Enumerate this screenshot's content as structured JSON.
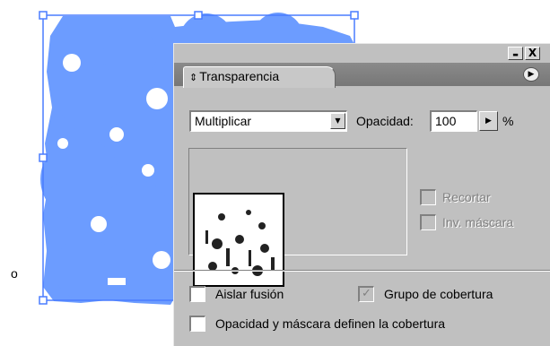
{
  "panel": {
    "tab_label": "Transparencia",
    "tab_icon": "double-arrow-icon",
    "minimize_symbol": "▬",
    "close_symbol": "X",
    "menu_symbol": "▶",
    "blend_mode": "Multiplicar",
    "opacity_label": "Opacidad:",
    "opacity_value": "100",
    "opacity_unit": "%",
    "clip_label": "Recortar",
    "invert_mask_label": "Inv. máscara",
    "isolate_blending_label": "Aislar fusión",
    "knockout_group_label": "Grupo de cobertura",
    "knockout_group_check": "✓",
    "opacity_mask_knockout_label": "Opacidad y máscara definen la cobertura"
  },
  "canvas": {
    "bullet": "o",
    "artwork_color": "#6c9cff",
    "selection_color": "#4a7dff"
  }
}
